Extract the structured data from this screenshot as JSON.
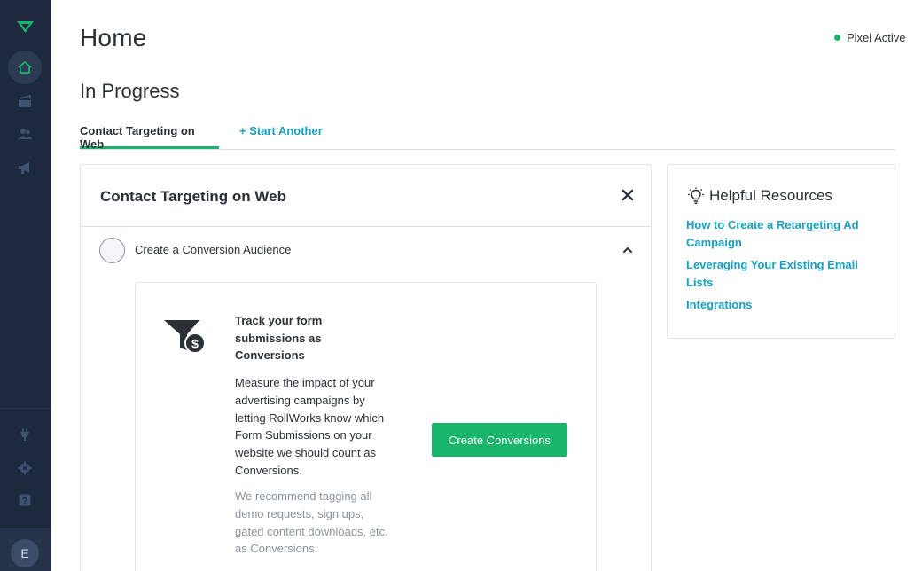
{
  "sidebar": {
    "avatar_initial": "E",
    "items": [
      {
        "icon": "home-icon",
        "active": true
      },
      {
        "icon": "campaign-icon",
        "active": false
      },
      {
        "icon": "audience-icon",
        "active": false
      },
      {
        "icon": "megaphone-icon",
        "active": false
      }
    ],
    "bottom_items": [
      {
        "icon": "plugin-icon"
      },
      {
        "icon": "settings-icon"
      },
      {
        "icon": "help-icon"
      }
    ]
  },
  "header": {
    "title": "Home",
    "pixel_status": "Pixel Active"
  },
  "section": {
    "title": "In Progress"
  },
  "tabs": [
    {
      "label": "Contact Targeting on Web",
      "active": true
    },
    {
      "label": "+ Start Another",
      "active": false
    }
  ],
  "card": {
    "title": "Contact Targeting on Web",
    "step": {
      "label": "Create a Conversion Audience"
    },
    "content": {
      "heading": "Track your form submissions as Conversions",
      "body": "Measure the impact of your advertising campaigns by letting RollWorks know which Form Submissions on your website we should count as Conversions.",
      "note": "We recommend tagging all demo requests, sign ups, gated content downloads, etc. as Conversions.",
      "button_label": "Create Conversions"
    }
  },
  "resources": {
    "title": "Helpful Resources",
    "links": [
      "How to Create a Retargeting Ad Campaign",
      "Leveraging Your Existing Email Lists",
      "Integrations"
    ]
  },
  "colors": {
    "sidebar_bg": "#1d2a3d",
    "accent_green": "#19b56a",
    "link_blue": "#1a9fbf"
  }
}
